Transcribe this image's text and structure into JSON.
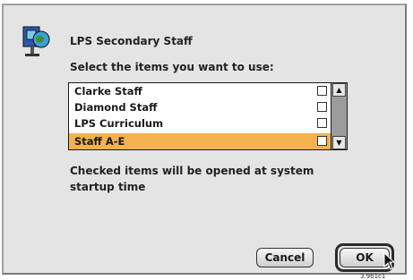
{
  "dialog": {
    "server_name": "LPS Secondary Staff",
    "prompt": "Select the items you want to use:",
    "items": [
      {
        "label": "Clarke Staff",
        "checked": false,
        "selected": false
      },
      {
        "label": "Diamond Staff",
        "checked": false,
        "selected": false
      },
      {
        "label": "LPS Curriculum",
        "checked": false,
        "selected": false
      },
      {
        "label": "Staff A-E",
        "checked": false,
        "selected": true
      }
    ],
    "info": "Checked items will be opened at system startup time",
    "buttons": {
      "cancel": "Cancel",
      "ok": "OK"
    },
    "version": "3.9b1c1",
    "colors": {
      "selection": "#f3b24e",
      "background": "#e4e4e4"
    }
  }
}
